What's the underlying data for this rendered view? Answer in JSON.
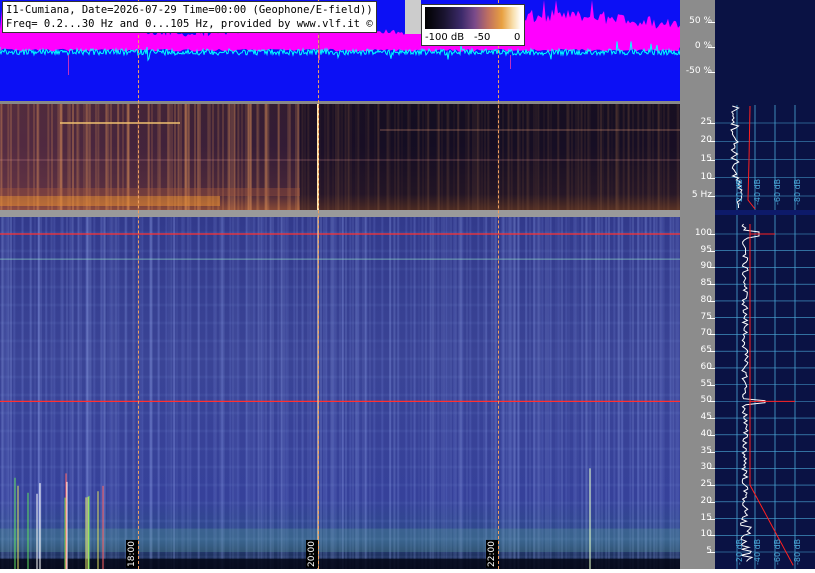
{
  "header": {
    "title_line1": "I1-Cumiana, Date=2026-07-29 Time=00:00 (Geophone/E-field))",
    "title_line2": "Freq= 0.2...30 Hz and 0...105 Hz, provided by www.vlf.it ©"
  },
  "colorbar": {
    "labels": [
      "-100 dB",
      "-50",
      "0"
    ]
  },
  "time_labels": [
    "18:00",
    "20:00",
    "22:00"
  ],
  "colors": {
    "waveform_bg": "#0c10f5",
    "waveform_envelope": "#ff00ff",
    "waveform_trace": "#00ffff",
    "highlight_line": "#ff3030",
    "profile_white": "#ffffff",
    "profile_red": "#ff2020",
    "grid_cyan": "#4aa8d8"
  },
  "chart_data": [
    {
      "type": "area",
      "panel": "amplitude",
      "yticks": [
        "50 %",
        "0 %",
        "-50 %"
      ],
      "ylim": [
        -100,
        100
      ],
      "yunit": "%"
    },
    {
      "type": "heatmap",
      "panel": "low-frequency spectrogram",
      "yticks": [
        "25",
        "20",
        "15",
        "10",
        "5 Hz"
      ],
      "yrange": [
        0.2,
        30
      ],
      "yunit": "Hz",
      "colorscale_db": [
        -100,
        0
      ]
    },
    {
      "type": "heatmap",
      "panel": "high-frequency spectrogram",
      "yticks": [
        "100",
        "95",
        "90",
        "85",
        "80",
        "75",
        "70",
        "65",
        "60",
        "55",
        "50",
        "45",
        "40",
        "35",
        "30",
        "25",
        "20",
        "15",
        "10",
        "5"
      ],
      "yrange": [
        0,
        105
      ],
      "yunit": "Hz",
      "highlight_lines_hz": [
        100,
        50
      ],
      "xticks": [
        "18:00",
        "20:00",
        "22:00"
      ]
    },
    {
      "type": "line",
      "panel": "spectral profiles",
      "xticks": [
        "-20 dB",
        "-40 dB",
        "-60 dB",
        "-80 dB"
      ],
      "lines_hz": [
        50,
        100
      ]
    }
  ]
}
